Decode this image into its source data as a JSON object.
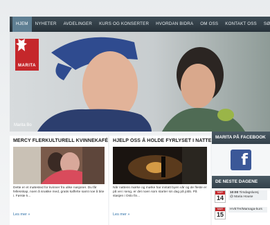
{
  "nav": {
    "items": [
      "HJEM",
      "NYHETER",
      "AVDELINGER",
      "KURS OG KONSERTER",
      "HVORDAN BIDRA",
      "OM OSS",
      "KONTAKT OSS",
      "SØK"
    ],
    "active_index": 0
  },
  "hero": {
    "logo_text": "MARITA",
    "caption": "Marita Bo"
  },
  "articles": [
    {
      "title": "MERCY FLERKULTURELL KVINNEKAFÉ",
      "body": "Dette er et møtested for kvinner fra ulike nasjoner. Du får fellesskap, noen å snakke med, gratis kaffe/te samt noe å bite i. Første k...",
      "more": "Les mer »"
    },
    {
      "title": "HJELP OSS Å HOLDE FYRLYSET I NATTEN TENT",
      "body": "Når nattens mørke og mørke har inntatt byen vår og de fleste er på vei i seng, er det noen som starter sin dag på jobb. På stasjen i Oslo fin...",
      "more": "Les mer »"
    }
  ],
  "sidebar": {
    "facebook_title": "MARITA PÅ FACEBOOK",
    "facebook_icon": "facebook-icon",
    "upcoming_title": "DE NESTE DAGENE",
    "events": [
      {
        "month": "MAR",
        "day": "14",
        "time": "10:00",
        "label": "Tirsdagslunsj",
        "place": "@ Maria House"
      },
      {
        "month": "MAR",
        "day": "15",
        "time": "",
        "label": "HVETH/Mamaga-kurs",
        "place": ""
      }
    ]
  }
}
